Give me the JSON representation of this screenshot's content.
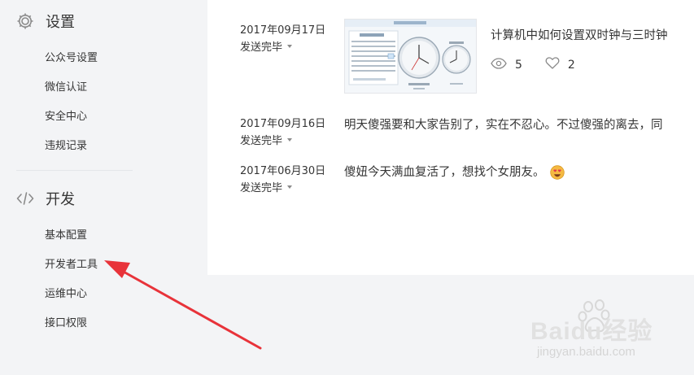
{
  "sidebar": {
    "groups": [
      {
        "title": "设置",
        "icon": "gear-icon",
        "items": [
          {
            "label": "公众号设置"
          },
          {
            "label": "微信认证"
          },
          {
            "label": "安全中心"
          },
          {
            "label": "违规记录"
          }
        ]
      },
      {
        "title": "开发",
        "icon": "code-icon",
        "items": [
          {
            "label": "基本配置"
          },
          {
            "label": "开发者工具"
          },
          {
            "label": "运维中心"
          },
          {
            "label": "接口权限"
          }
        ]
      }
    ]
  },
  "messages": [
    {
      "date": "2017年09月17日",
      "status": "发送完毕",
      "title": "计算机中如何设置双时钟与三时钟",
      "thumbnail": "clock-settings-thumbnail",
      "stats": {
        "views": "5",
        "likes": "2"
      }
    },
    {
      "date": "2017年09月16日",
      "status": "发送完毕",
      "text": "明天傻强要和大家告别了，实在不忍心。不过傻强的离去，同"
    },
    {
      "date": "2017年06月30日",
      "status": "发送完毕",
      "text": "傻妞今天满血复活了，想找个女朋友。",
      "emoji": "heart-eyes-emoji"
    }
  ],
  "watermark": {
    "brand": "Baidu经验",
    "url": "jingyan.baidu.com"
  },
  "colors": {
    "page_bg": "#f3f4f6",
    "panel_bg": "#ffffff",
    "arrow": "#e8333a"
  }
}
